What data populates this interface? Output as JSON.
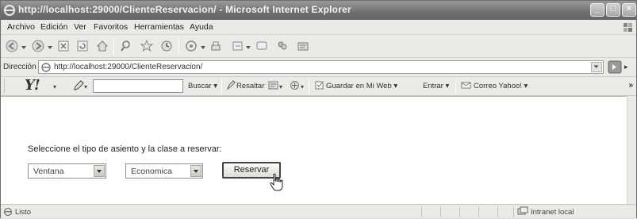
{
  "window": {
    "title": "http://localhost:29000/ClienteReservacion/ - Microsoft Internet Explorer"
  },
  "menu": {
    "items": [
      "Archivo",
      "Edición",
      "Ver",
      "Favoritos",
      "Herramientas",
      "Ayuda"
    ]
  },
  "toolbar": {
    "buttons": [
      "back-icon",
      "forward-icon",
      "stop-icon",
      "refresh-icon",
      "home-icon",
      "search-icon",
      "favorites-icon",
      "history-icon",
      "messenger-icon",
      "print-icon",
      "edit-icon",
      "mail-icon",
      "research-icon",
      "discuss-icon",
      "media-icon"
    ]
  },
  "address": {
    "label": "Dirección",
    "url": "http://localhost:29000/ClienteReservacion/"
  },
  "yahoo": {
    "logo": "Y!",
    "search_value": "",
    "buscar": "Buscar",
    "resaltar": "Resaltar",
    "guardar": "Guardar en Mi Web",
    "entrar": "Entrar",
    "correo": "Correo Yahoo!",
    "more": "»"
  },
  "form": {
    "prompt": "Seleccione el tipo de asiento y la clase a reservar:",
    "seat_type": "Ventana",
    "class_type": "Economica",
    "submit_label": "Reservar"
  },
  "status": {
    "text": "Listo",
    "zone": "Intranet local"
  },
  "colors": {
    "titlebar": "#7a7a7a",
    "chrome": "#ebeae6",
    "content": "#ffffff"
  }
}
